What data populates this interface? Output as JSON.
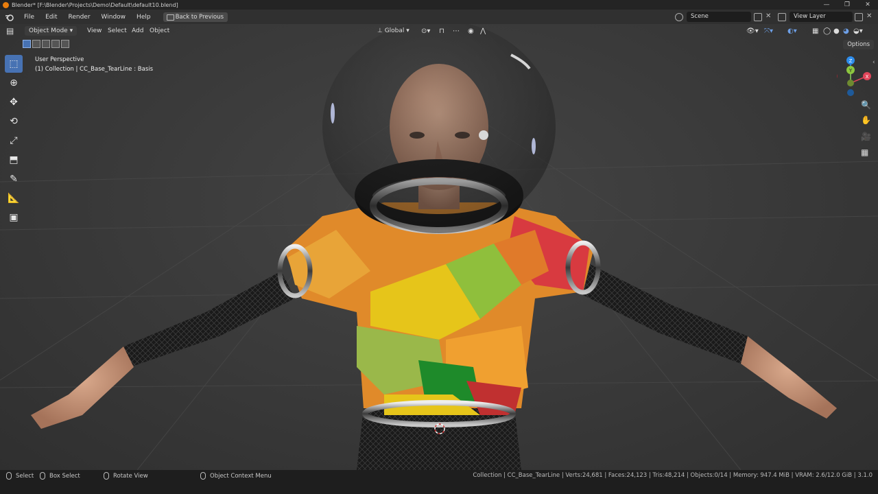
{
  "window": {
    "title": "Blender* [F:\\Blender\\Projects\\Demo\\Default\\default10.blend]",
    "controls": [
      "—",
      "❐",
      "✕"
    ]
  },
  "menubar": {
    "items": [
      "File",
      "Edit",
      "Render",
      "Window",
      "Help"
    ],
    "back_button": "Back to Previous",
    "scene_label": "Scene",
    "view_layer_label": "View Layer"
  },
  "viewport_header": {
    "mode": "Object Mode",
    "menus": [
      "View",
      "Select",
      "Add",
      "Object"
    ],
    "transform_orientation": "Global",
    "options_label": "Options"
  },
  "viewport": {
    "perspective": "User Perspective",
    "collection_info": "(1) Collection | CC_Base_TearLine : Basis",
    "gizmo": {
      "z": "Z",
      "x": "X",
      "y": "Y"
    },
    "colors": {
      "x_axis": "#e0455a",
      "y_axis": "#8cc63f",
      "z_axis": "#2d8ceb",
      "active": "#4772b3"
    }
  },
  "toolbar": {
    "tools": [
      {
        "name": "select-box-tool",
        "glyph": "⬚",
        "active": true
      },
      {
        "name": "cursor-tool",
        "glyph": "⊕",
        "active": false
      },
      {
        "name": "move-tool",
        "glyph": "✥",
        "active": false
      },
      {
        "name": "rotate-tool",
        "glyph": "⟲",
        "active": false
      },
      {
        "name": "scale-tool",
        "glyph": "⤢",
        "active": false
      },
      {
        "name": "transform-tool",
        "glyph": "⬒",
        "active": false
      },
      {
        "name": "annotate-tool",
        "glyph": "✎",
        "active": false
      },
      {
        "name": "measure-tool",
        "glyph": "📐",
        "active": false
      },
      {
        "name": "add-cube-tool",
        "glyph": "▣",
        "active": false
      }
    ]
  },
  "statusbar": {
    "select": "Select",
    "box_select": "Box Select",
    "rotate_view": "Rotate View",
    "context_menu": "Object Context Menu",
    "stats": "Collection | CC_Base_TearLine | Verts:24,681 | Faces:24,123 | Tris:48,214 | Objects:0/14 | Memory: 947.4 MiB | VRAM: 2.6/12.0 GiB | 3.1.0"
  }
}
